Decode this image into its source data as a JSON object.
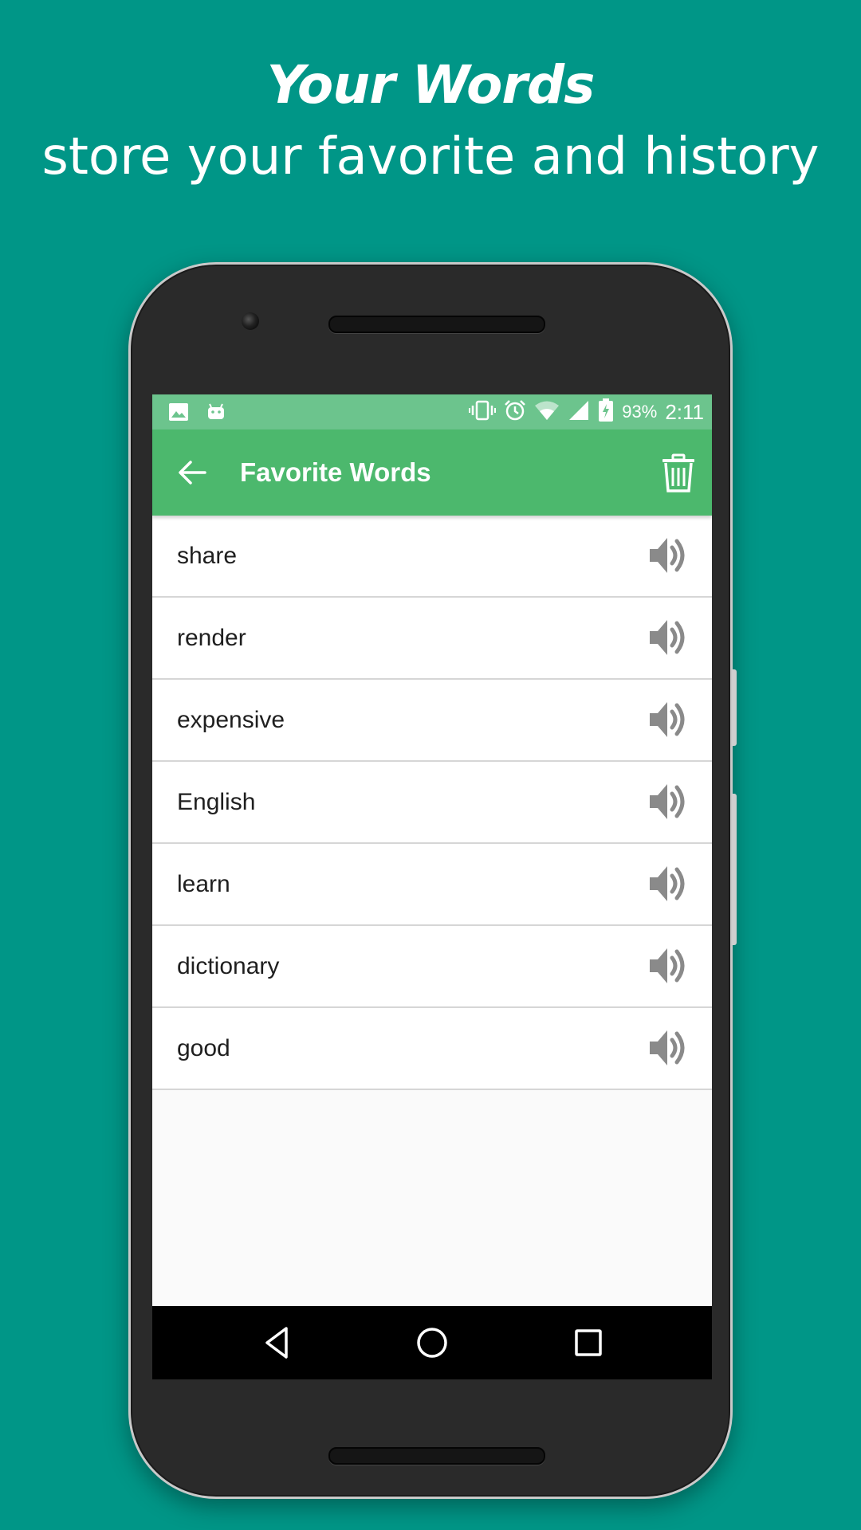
{
  "headline": {
    "title": "Your Words",
    "subtitle": "store your favorite and history"
  },
  "status_bar": {
    "left_icons": [
      "image-icon",
      "android-icon"
    ],
    "right_icons": [
      "vibrate-icon",
      "alarm-icon",
      "wifi-icon",
      "signal-icon",
      "battery-charging-icon"
    ],
    "battery": "93%",
    "time": "2:11"
  },
  "app_bar": {
    "title": "Favorite Words",
    "back_icon": "arrow-back-icon",
    "delete_icon": "trash-icon"
  },
  "words": [
    {
      "word": "share"
    },
    {
      "word": "render"
    },
    {
      "word": "expensive"
    },
    {
      "word": "English"
    },
    {
      "word": "learn"
    },
    {
      "word": "dictionary"
    },
    {
      "word": "good"
    }
  ],
  "nav_bar": {
    "buttons": [
      "back-triangle-icon",
      "home-circle-icon",
      "recents-square-icon"
    ]
  },
  "colors": {
    "background": "#009687",
    "status_bar": "#6cc48d",
    "app_bar": "#4cb86d",
    "speaker_icon": "#8a8a8a"
  }
}
